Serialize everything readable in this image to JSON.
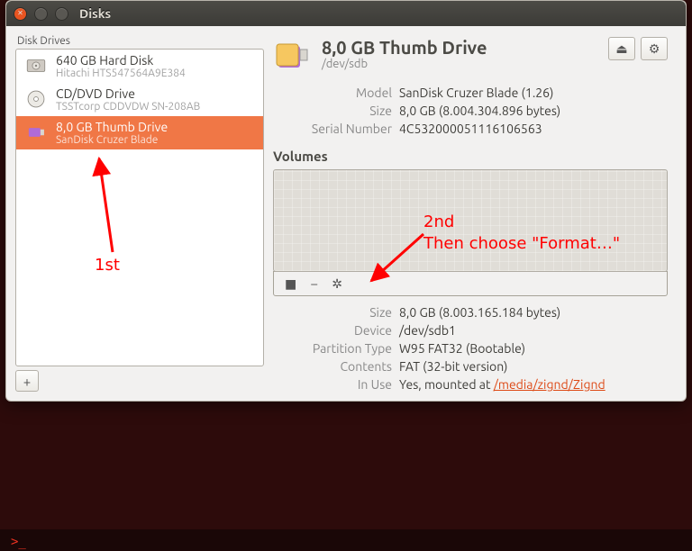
{
  "window": {
    "title": "Disks",
    "left_heading": "Disk Drives",
    "add_btn": "+"
  },
  "drives": [
    {
      "name": "640 GB Hard Disk",
      "sub": "Hitachi HTS547564A9E384"
    },
    {
      "name": "CD/DVD Drive",
      "sub": "TSSTcorp CDDVDW SN-208AB"
    },
    {
      "name": "8,0 GB Thumb Drive",
      "sub": "SanDisk Cruzer Blade"
    }
  ],
  "detail": {
    "title": "8,0 GB Thumb Drive",
    "device": "/dev/sdb",
    "eject_glyph": "⏏",
    "gear_glyph": "⚙",
    "rows": {
      "model_k": "Model",
      "model_v": "SanDisk Cruzer Blade (1.26)",
      "size_k": "Size",
      "size_v": "8,0 GB (8.004.304.896 bytes)",
      "serial_k": "Serial Number",
      "serial_v": "4C532000051116106563"
    },
    "volumes_heading": "Volumes",
    "volbar": {
      "stop": "■",
      "minus": "–",
      "gear": "✲"
    },
    "vol": {
      "size_k": "Size",
      "size_v": "8,0 GB (8.003.165.184 bytes)",
      "device_k": "Device",
      "device_v": "/dev/sdb1",
      "ptype_k": "Partition Type",
      "ptype_v": "W95 FAT32 (Bootable)",
      "contents_k": "Contents",
      "contents_v": "FAT (32-bit version)",
      "inuse_k": "In Use",
      "inuse_pre": "Yes, mounted at ",
      "inuse_link": "/media/zignd/Zignd"
    }
  },
  "annotations": {
    "first": "1st",
    "second_a": "2nd",
    "second_b": "Then choose \"Format…\""
  }
}
